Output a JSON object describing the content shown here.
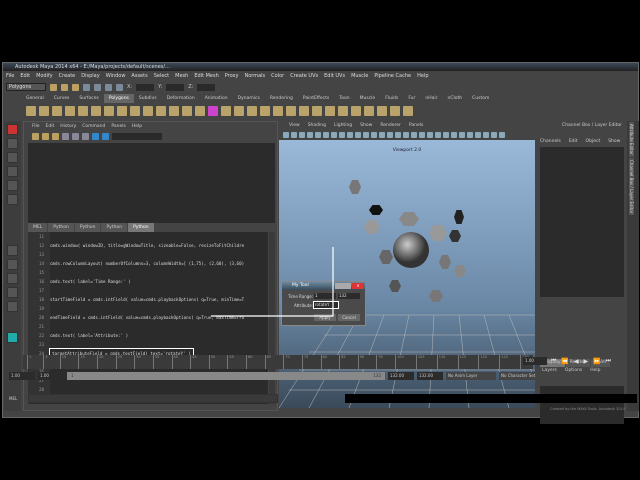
{
  "window": {
    "title": "Autodesk Maya 2014 x64 - E:/Maya/projects/default/scenes/..."
  },
  "menubar": [
    "File",
    "Edit",
    "Modify",
    "Create",
    "Display",
    "Window",
    "Assets",
    "Select",
    "Mesh",
    "Edit Mesh",
    "Proxy",
    "Normals",
    "Color",
    "Create UVs",
    "Edit UVs",
    "Muscle",
    "Pipeline Cache",
    "Help"
  ],
  "status": {
    "mode": "Polygons",
    "x_label": "X:",
    "y_label": "Y:",
    "z_label": "Z:"
  },
  "shelf_tabs": [
    "General",
    "Curves",
    "Surfaces",
    "Polygons",
    "Subdivs",
    "Deformation",
    "Animation",
    "Dynamics",
    "Rendering",
    "PaintEffects",
    "Toon",
    "Muscle",
    "Fluids",
    "Fur",
    "nHair",
    "nCloth",
    "Custom"
  ],
  "shelf_active": "Polygons",
  "script_editor": {
    "menu": [
      "File",
      "Edit",
      "History",
      "Command",
      "Panels",
      "Help"
    ],
    "tabs": [
      "MEL",
      "Python",
      "Python",
      "Python",
      "Python"
    ],
    "active_tab": 4,
    "lines": [
      {
        "n": "11",
        "c": ""
      },
      {
        "n": "12",
        "c": "cmds.window( windowID, title=gWindowTitle, sizeable=False, resizeToFitChildre"
      },
      {
        "n": "13",
        "c": ""
      },
      {
        "n": "14",
        "c": "cmds.rowColumnLayout( numberOfColumns=3, columnWidth=[ (1,75), (2,60), (3,60)"
      },
      {
        "n": "15",
        "c": ""
      },
      {
        "n": "16",
        "c": "cmds.text( label='Time Range:' )"
      },
      {
        "n": "17",
        "c": ""
      },
      {
        "n": "18",
        "c": "startTimeField = cmds.intField( value=cmds.playbackOptions( q=True, minTime=T"
      },
      {
        "n": "19",
        "c": ""
      },
      {
        "n": "20",
        "c": "endTimeField = cmds.intField( value=cmds.playbackOptions( q=True, maxTime=Tru"
      },
      {
        "n": "21",
        "c": ""
      },
      {
        "n": "22",
        "c": "cmds.text( label='Attribute:' )"
      },
      {
        "n": "23",
        "c": ""
      },
      {
        "n": "24",
        "c": "targetAttributeField = cmds.textField( text='rotateY' )"
      },
      {
        "n": "25",
        "c": ""
      },
      {
        "n": "26",
        "c": ""
      },
      {
        "n": "27",
        "c": ""
      },
      {
        "n": "28",
        "c": ""
      },
      {
        "n": "29",
        "c": ""
      }
    ],
    "highlighted_line": "24"
  },
  "viewport": {
    "menu": [
      "View",
      "Shading",
      "Lighting",
      "Show",
      "Renderer",
      "Panels"
    ],
    "label": "Viewport 2.0"
  },
  "channel_box": {
    "title": "Channel Box / Layer Editor",
    "menu": [
      "Channels",
      "Edit",
      "Object",
      "Show"
    ],
    "layer_tabs": [
      "Display",
      "Render",
      "Anim"
    ],
    "layer_menu": [
      "Layers",
      "Options",
      "Help"
    ]
  },
  "side_tabs": [
    "Attribute Editor",
    "Channel Box / Layer Editor"
  ],
  "dialog": {
    "title": "My Tool",
    "time_range_label": "Time Range:",
    "start": "1",
    "end": "132",
    "attribute_label": "Attribute:",
    "attribute_value": "rotateY",
    "apply": "Apply",
    "cancel": "Cancel"
  },
  "timeline": {
    "ticks": [
      "1",
      "5",
      "10",
      "15",
      "20",
      "25",
      "30",
      "35",
      "40",
      "45",
      "50",
      "55",
      "60",
      "65",
      "70",
      "75",
      "80",
      "85",
      "90",
      "95",
      "100",
      "105",
      "110",
      "115",
      "120",
      "125",
      "130"
    ],
    "current_frame": "1.00"
  },
  "range": {
    "start": "1.00",
    "current": "1.00",
    "slider_start": "1",
    "slider_end": "132",
    "end": "132.00",
    "end2": "132.00",
    "anim_layer": "No Anim Layer",
    "character_set": "No Character Set"
  },
  "command_line": {
    "label": "MEL"
  },
  "help_line": "Created by the MAYA Tools. Autodesk 2014"
}
